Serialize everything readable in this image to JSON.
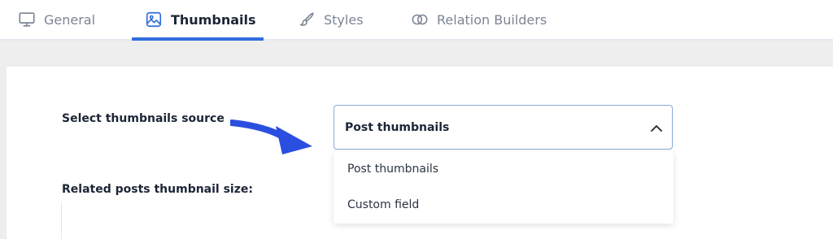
{
  "tabs": [
    {
      "label": "General",
      "icon": "monitor-icon",
      "active": false
    },
    {
      "label": "Thumbnails",
      "icon": "image-icon",
      "active": true
    },
    {
      "label": "Styles",
      "icon": "brush-icon",
      "active": false
    },
    {
      "label": "Relation Builders",
      "icon": "overlapping-circles-icon",
      "active": false
    }
  ],
  "form": {
    "source_label": "Select thumbnails source",
    "size_label": "Related posts thumbnail size:"
  },
  "select": {
    "value": "Post thumbnails",
    "state": "open",
    "options": [
      "Post thumbnails",
      "Custom field"
    ]
  },
  "colors": {
    "accent": "#2f6bdc",
    "arrow": "#2a4fe0",
    "tab_border": "#e4e9f1",
    "background": "#eeeeee"
  }
}
